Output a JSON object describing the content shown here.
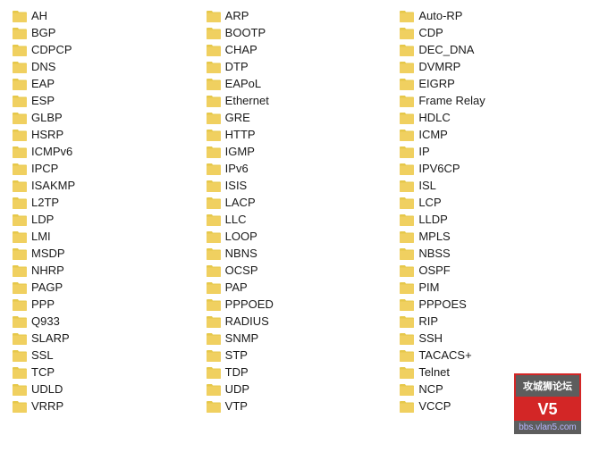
{
  "columns": [
    {
      "id": "col1",
      "items": [
        "AH",
        "BGP",
        "CDPCP",
        "DNS",
        "EAP",
        "ESP",
        "GLBP",
        "HSRP",
        "ICMPv6",
        "IPCP",
        "ISAKMP",
        "L2TP",
        "LDP",
        "LMI",
        "MSDP",
        "NHRP",
        "PAGP",
        "PPP",
        "Q933",
        "SLARP",
        "SSL",
        "TCP",
        "UDLD",
        "VRRP"
      ]
    },
    {
      "id": "col2",
      "items": [
        "ARP",
        "BOOTP",
        "CHAP",
        "DTP",
        "EAPoL",
        "Ethernet",
        "GRE",
        "HTTP",
        "IGMP",
        "IPv6",
        "ISIS",
        "LACP",
        "LLC",
        "LOOP",
        "NBNS",
        "OCSP",
        "PAP",
        "PPPOED",
        "RADIUS",
        "SNMP",
        "STP",
        "TDP",
        "UDP",
        "VTP"
      ]
    },
    {
      "id": "col3",
      "items": [
        "Auto-RP",
        "CDP",
        "DEC_DNA",
        "DVMRP",
        "EIGRP",
        "Frame Relay",
        "HDLC",
        "ICMP",
        "IP",
        "IPV6CP",
        "ISL",
        "LCP",
        "LLDP",
        "MPLS",
        "NBSS",
        "OSPF",
        "PIM",
        "PPPOES",
        "RIP",
        "SSH",
        "TACACS+",
        "Telnet",
        "NCP",
        "VCCP"
      ]
    }
  ],
  "watermark": {
    "site": "攻城狮论坛",
    "v5": "V5",
    "url": "bbs.vlan5.com"
  },
  "folder_color": "#e6c84a"
}
